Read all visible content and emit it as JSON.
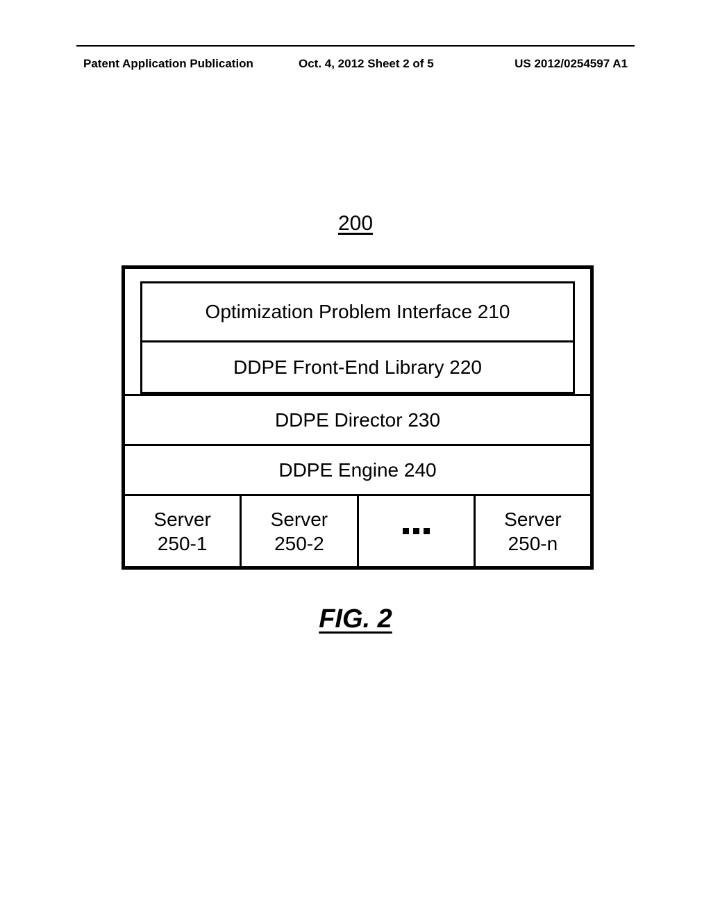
{
  "header": {
    "left": "Patent Application Publication",
    "center": "Oct. 4, 2012  Sheet 2 of 5",
    "right": "US 2012/0254597 A1"
  },
  "figure_number": "200",
  "blocks": {
    "b210": "Optimization Problem Interface  210",
    "b220": "DDPE Front-End Library  220",
    "b230": "DDPE Director 230",
    "b240": "DDPE Engine 240"
  },
  "servers": {
    "s1_line1": "Server",
    "s1_line2": "250-1",
    "s2_line1": "Server",
    "s2_line2": "250-2",
    "sn_line1": "Server",
    "sn_line2": "250-n"
  },
  "figure_caption": "FIG. 2"
}
